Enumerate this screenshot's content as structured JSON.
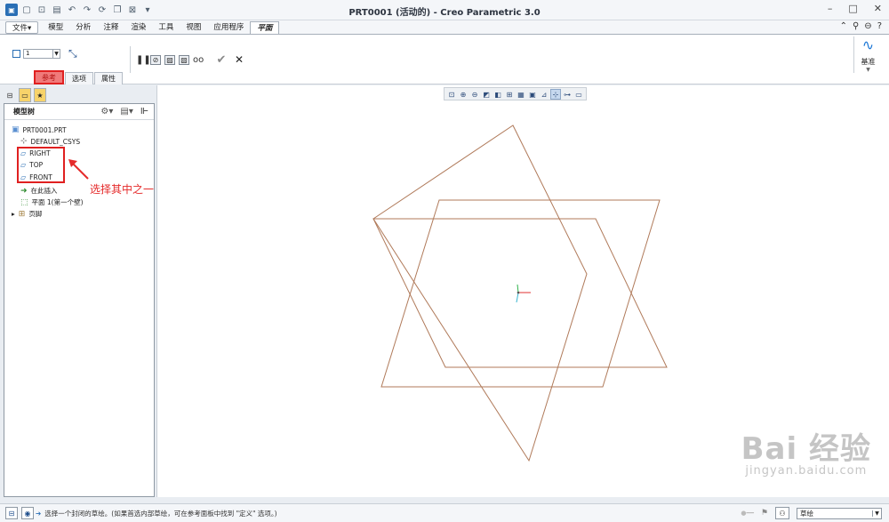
{
  "window": {
    "title": "PRT0001 (活动的) - Creo Parametric 3.0",
    "quick_access_icons": [
      "app-icon",
      "new-icon",
      "open-icon",
      "save-icon",
      "undo-icon",
      "redo-icon",
      "regenerate-icon",
      "windows-icon",
      "close-window-icon",
      "customize-icon"
    ]
  },
  "menu": {
    "file": "文件▾",
    "tabs": [
      "模型",
      "分析",
      "注释",
      "渲染",
      "工具",
      "视图",
      "应用程序"
    ],
    "active_tab": "平面"
  },
  "ribbon": {
    "reference_value": "1",
    "subtabs": {
      "references": "参考",
      "options": "选项",
      "properties": "属性"
    },
    "datum_label": "基准"
  },
  "model_tree": {
    "title": "模型树",
    "root": "PRT0001.PRT",
    "items": [
      "DEFAULT_CSYS",
      "RIGHT",
      "TOP",
      "FRONT",
      "在此插入",
      "平面 1(第一个壁)",
      "页脚"
    ]
  },
  "annotation": {
    "text": "选择其中之一",
    "color": "#e52b2b"
  },
  "status": {
    "message": "选择一个封闭的草绘。(如果首选内部草绘，可在参考面板中找到 \"定义\" 选项。)",
    "filter": "草绘"
  },
  "watermark": {
    "brand": "Bai 经验",
    "url": "jingyan.baidu.com"
  },
  "colors": {
    "sketch_line": "#b07a5a",
    "highlight": "#e02020",
    "accent": "#2a6fb5"
  }
}
